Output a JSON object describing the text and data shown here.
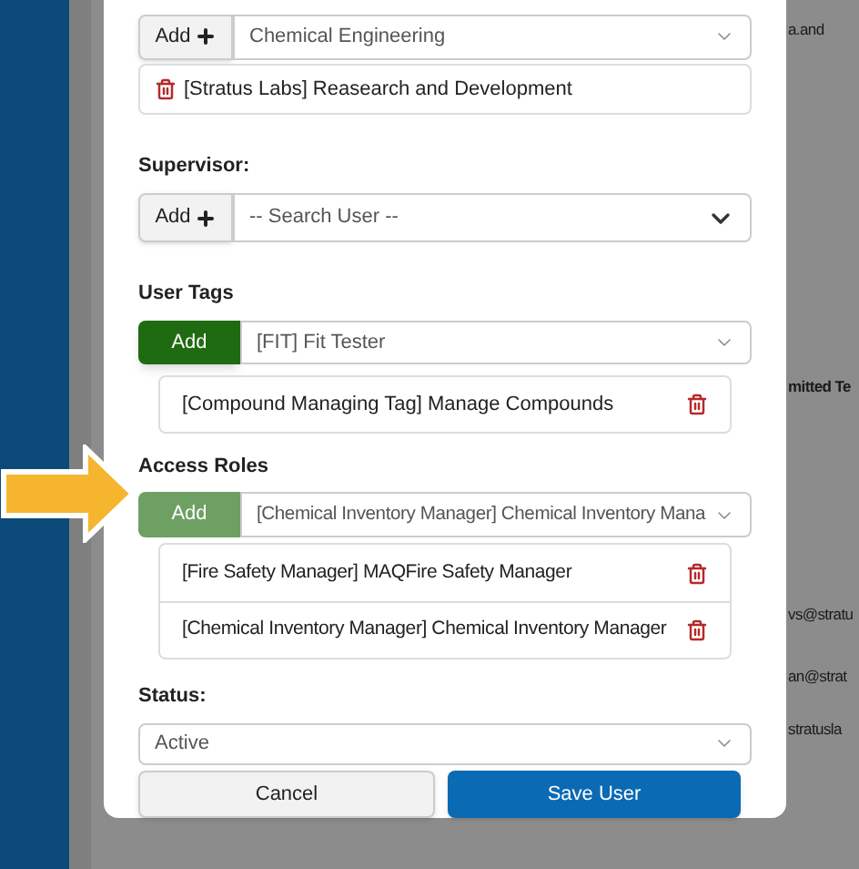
{
  "department": {
    "add_label": "Add",
    "select_value": "Chemical Engineering",
    "items": [
      "[Stratus Labs] Reasearch and Development"
    ]
  },
  "supervisor": {
    "label": "Supervisor:",
    "add_label": "Add",
    "placeholder": "-- Search User --"
  },
  "user_tags": {
    "label": "User Tags",
    "add_label": "Add",
    "add_dimmed": false,
    "select_value": "[FIT] Fit Tester",
    "items": [
      "[Compound Managing Tag] Manage Compounds"
    ]
  },
  "access_roles": {
    "label": "Access Roles",
    "add_label": "Add",
    "add_dimmed": true,
    "select_value": "[Chemical Inventory Manager] Chemical Inventory Mana",
    "items": [
      "[Fire Safety Manager] MAQFire Safety Manager",
      "[Chemical Inventory Manager] Chemical Inventory Manager"
    ]
  },
  "status": {
    "label": "Status:",
    "value": "Active"
  },
  "buttons": [
    {
      "label": "Cancel",
      "kind": "secondary"
    },
    {
      "label": "Save User",
      "kind": "primary"
    }
  ],
  "background": [
    {
      "text": "a.and",
      "kind": "cell"
    },
    {
      "text": "mitted Te",
      "kind": "header"
    },
    {
      "text": "vs@stratu",
      "kind": "cell"
    },
    {
      "text": "an@strat",
      "kind": "cell"
    },
    {
      "text": "stratusla",
      "kind": "cell"
    }
  ]
}
